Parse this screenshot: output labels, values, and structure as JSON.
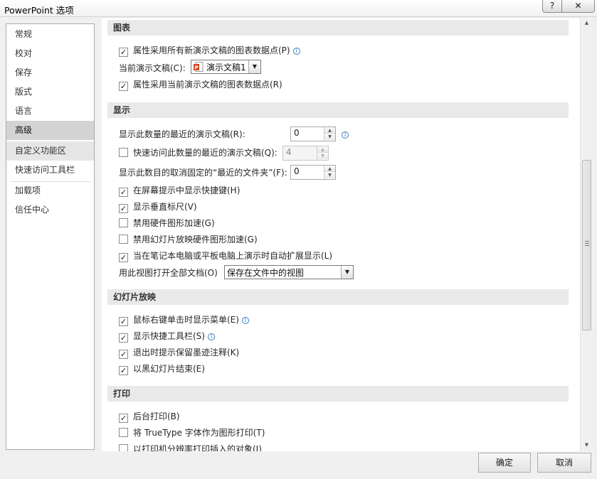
{
  "window": {
    "title": "PowerPoint 选项",
    "help_glyph": "?",
    "close_glyph": "✕"
  },
  "nav": {
    "items": [
      "常规",
      "校对",
      "保存",
      "版式",
      "语言",
      "高级",
      "自定义功能区",
      "快速访问工具栏",
      "加载项",
      "信任中心"
    ],
    "selected": "高级"
  },
  "sections": {
    "chart": {
      "title": "图表",
      "cb_all_new": "属性采用所有新演示文稿的图表数据点(P)",
      "current_label": "当前演示文稿(C):",
      "current_value": "演示文稿1",
      "cb_current": "属性采用当前演示文稿的图表数据点(R)"
    },
    "display": {
      "title": "显示",
      "recent_label": "显示此数量的最近的演示文稿(R):",
      "recent_value": "0",
      "quick_access_label": "快速访问此数量的最近的演示文稿(Q):",
      "quick_access_value": "4",
      "unpinned_label": "显示此数目的取消固定的“最近的文件夹”(F):",
      "unpinned_value": "0",
      "cb_shortcut_keys": "在屏幕提示中显示快捷键(H)",
      "cb_vertical_ruler": "显示垂直标尺(V)",
      "cb_disable_hw_accel": "禁用硬件图形加速(G)",
      "cb_disable_slideshow_hw": "禁用幻灯片放映硬件图形加速(G)",
      "cb_auto_extend": "当在笔记本电脑或平板电脑上演示时自动扩展显示(L)",
      "open_view_label": "用此视图打开全部文档(O)",
      "open_view_value": "保存在文件中的视图"
    },
    "slideshow": {
      "title": "幻灯片放映",
      "cb_right_click": "鼠标右键单击时显示菜单(E)",
      "cb_popup_toolbar": "显示快捷工具栏(S)",
      "cb_keep_ink": "退出时提示保留墨迹注释(K)",
      "cb_end_black": "以黑幻灯片结束(E)"
    },
    "print": {
      "title": "打印",
      "cb_background": "后台打印(B)",
      "cb_truetype": "将 TrueType 字体作为图形打印(T)",
      "cb_printer_res": "以打印机分辨率打印插入的对象(I)"
    }
  },
  "checked_glyph": "✓",
  "footer": {
    "ok": "确定",
    "cancel": "取消"
  },
  "colors": {
    "selected_nav": "#d3d3d3",
    "section_header": "#e9e9e9",
    "info_icon": "#3a7cc7",
    "ppt_icon": "#d24726"
  }
}
